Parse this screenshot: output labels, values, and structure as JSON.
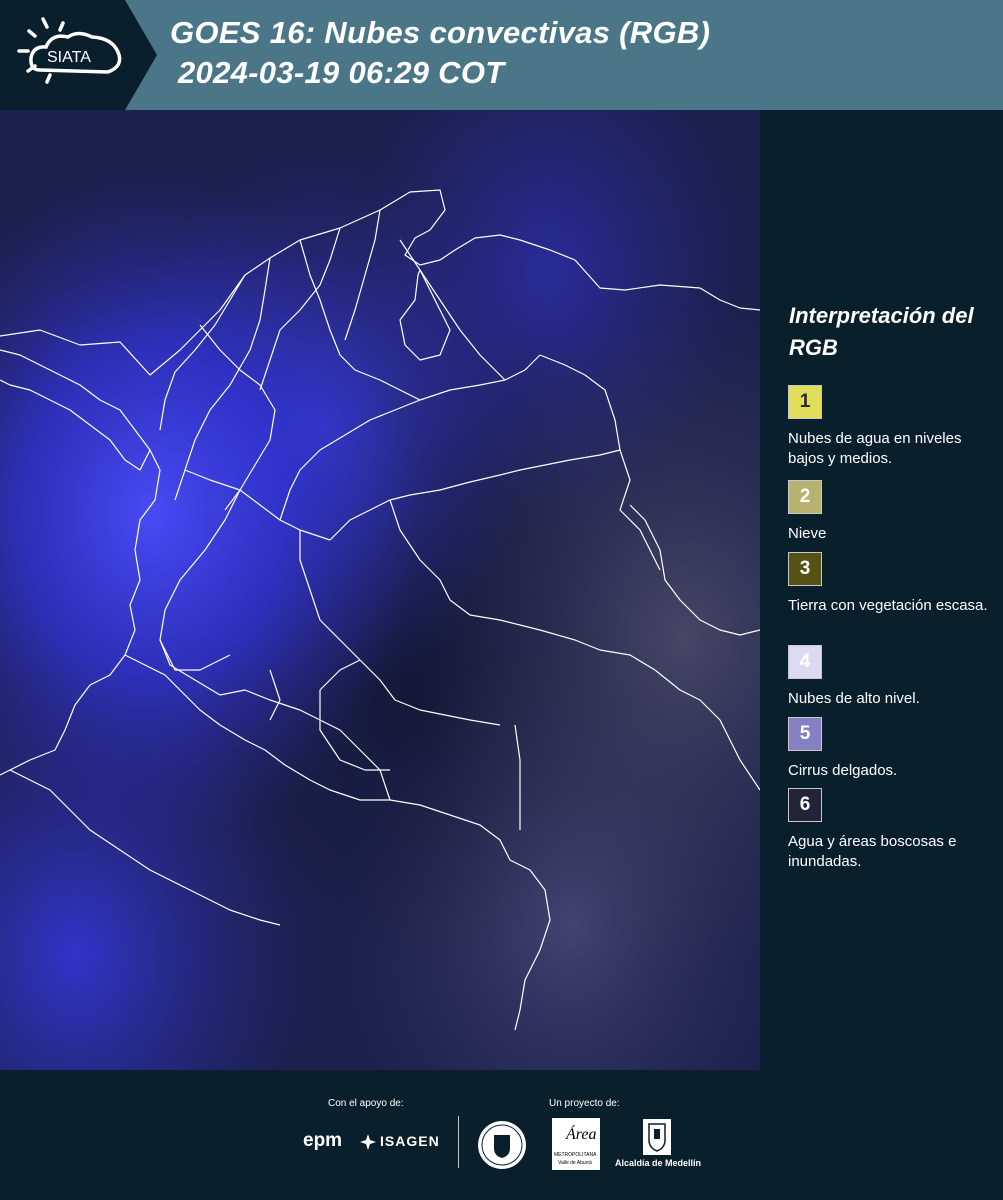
{
  "header": {
    "logo_text": "SIATA",
    "title_line1": "GOES 16: Nubes convectivas (RGB)",
    "title_line2": "2024-03-19 06:29 COT"
  },
  "map": {
    "imagery": "GOES-16 convective clouds RGB composite over Colombia",
    "colors": {
      "clouds_bright": "#3a3cff",
      "clouds_mid": "#2a2c9a",
      "clear_dark": "#141a3a",
      "border": "#ffffff"
    }
  },
  "legend": {
    "title": "Interpretación del RGB",
    "items": [
      {
        "number": "1",
        "label": "Nubes de agua en niveles bajos y medios.",
        "color": "#e3dd5c",
        "text_color": "#2a2a2a"
      },
      {
        "number": "2",
        "label": "Nieve",
        "color": "#b9b16f",
        "text_color": "#ffffff"
      },
      {
        "number": "3",
        "label": "Tierra con vegetación escasa.",
        "color": "#565114",
        "text_color": "#ffffff"
      },
      {
        "number": "4",
        "label": "Nubes de alto nivel.",
        "color": "#dcdaf3",
        "text_color": "#ffffff"
      },
      {
        "number": "5",
        "label": "Cirrus delgados.",
        "color": "#8480c2",
        "text_color": "#ffffff"
      },
      {
        "number": "6",
        "label": "Agua y áreas boscosas e inundadas.",
        "color": "#242438",
        "text_color": "#ffffff"
      }
    ]
  },
  "footer": {
    "support_label": "Con el apoyo de:",
    "project_label": "Un proyecto de:",
    "epm": "epm",
    "isagen": "ISAGEN",
    "area_word": "Área",
    "area_sub1": "METROPOLITANA",
    "area_sub2": "Valle de Aburrá",
    "alcaldia": "Alcaldía de Medellín"
  }
}
